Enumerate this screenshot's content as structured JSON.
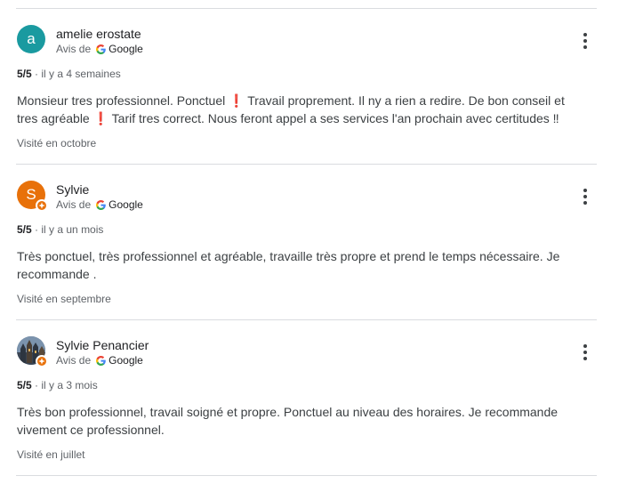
{
  "colors": {
    "avatar_teal": "#1a9aa0",
    "avatar_orange": "#e8710a",
    "divider": "#dadce0"
  },
  "reviews": [
    {
      "author": "amelie erostate",
      "avatar_letter": "a",
      "avatar_color": "#1a9aa0",
      "avatar_type": "letter",
      "local_guide": false,
      "source_prefix": "Avis de",
      "source_name": "Google",
      "rating": "5/5",
      "separator": "·",
      "time_ago": "il y a 4 semaines",
      "text": "Monsieur tres professionnel. Ponctuel ❗ Travail proprement. Il ny a rien a redire. De bon conseil et tres agréable ❗ Tarif tres correct. Nous feront appel a ses services l'an prochain avec certitudes ‼",
      "visited": "Visité en octobre",
      "more_icon": "more-vert-icon"
    },
    {
      "author": "Sylvie",
      "avatar_letter": "S",
      "avatar_color": "#e8710a",
      "avatar_type": "letter",
      "local_guide": true,
      "source_prefix": "Avis de",
      "source_name": "Google",
      "rating": "5/5",
      "separator": "·",
      "time_ago": "il y a un mois",
      "text": "Très ponctuel, très professionnel et agréable, travaille très propre et prend le temps nécessaire. Je recommande .",
      "visited": "Visité en septembre",
      "more_icon": "more-vert-icon"
    },
    {
      "author": "Sylvie Penancier",
      "avatar_letter": "",
      "avatar_color": "#3e4a5a",
      "avatar_type": "photo",
      "local_guide": true,
      "source_prefix": "Avis de",
      "source_name": "Google",
      "rating": "5/5",
      "separator": "·",
      "time_ago": "il y a 3 mois",
      "text": "Très bon professionnel, travail soigné et propre. Ponctuel au niveau des horaires. Je recommande vivement ce professionnel.",
      "visited": "Visité en juillet",
      "more_icon": "more-vert-icon"
    }
  ]
}
